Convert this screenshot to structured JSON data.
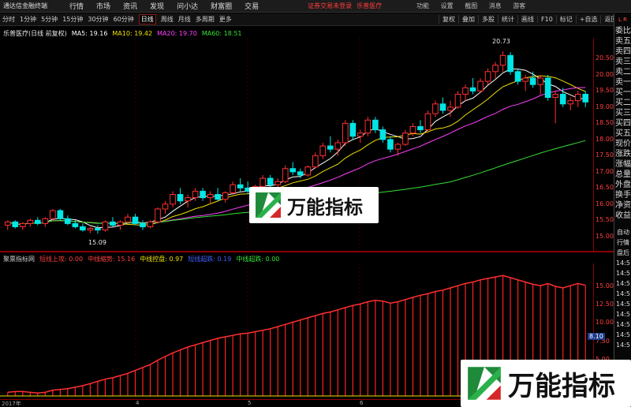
{
  "app": {
    "title": "通达信金融终端"
  },
  "menu": [
    "行情",
    "市场",
    "资讯",
    "发现",
    "问小达",
    "财富圈",
    "交易"
  ],
  "status": {
    "notice": "证券交易未登录",
    "stock": "乐普医疗"
  },
  "window_controls": [
    "功能",
    "设置",
    "截图",
    "消息"
  ],
  "guest": "游客",
  "periods": [
    "分时",
    "1分钟",
    "5分钟",
    "15分钟",
    "30分钟",
    "60分钟",
    "日线",
    "周线",
    "月线",
    "多周期",
    "更多"
  ],
  "selected_period": "日线",
  "toolbar": [
    "复权",
    "叠加",
    "多股",
    "统计",
    "画线",
    "F10",
    "标记",
    "+自选",
    "返回"
  ],
  "info": {
    "stock_label": "乐普医疗(日线 前复权)",
    "ma5": "MA5: 19.16",
    "ma10": "MA10: 19.42",
    "ma20": "MA20: 19.70",
    "ma60": "MA60: 18.51"
  },
  "annotations": {
    "high": "20.73",
    "low": "15.09"
  },
  "y_ticks": [
    "20.50",
    "20.00",
    "19.50",
    "19.00",
    "18.50",
    "18.00",
    "17.50",
    "17.00",
    "16.50",
    "16.00",
    "15.50",
    "15.00"
  ],
  "indicator": {
    "name": "聚票指标网",
    "s1": "短线上攻: 0.00",
    "s2": "中线缩势: 15.16",
    "s3": "中线控盘: 0.97",
    "s4": "短线超跌: 0.19",
    "s5": "中线超跌: 0.00"
  },
  "ind_ticks": [
    "15.00",
    "12.50",
    "10.00",
    "7.50",
    "5.00",
    "2.50"
  ],
  "ind_value_tag": "8.10",
  "x_labels": [
    "2017年",
    "4",
    "5",
    "6"
  ],
  "right_panel": {
    "top": "L R",
    "labels": [
      "委比",
      "卖五",
      "卖四",
      "卖三",
      "卖二",
      "卖一",
      "买一",
      "买二",
      "买三",
      "买四",
      "买五",
      "现价",
      "涨跌",
      "涨幅",
      "总量",
      "外盘",
      "换手",
      "净资",
      "收益"
    ],
    "labels2": [
      "自动",
      "行情",
      "盘后",
      "14:5",
      "14:5",
      "14:5",
      "14:5",
      "14:5",
      "14:5",
      "14:5",
      "14:5",
      "14:5"
    ]
  },
  "watermark": {
    "text": "万能指标"
  },
  "chart_data": {
    "type": "candlestick",
    "y_range": [
      14.8,
      20.9
    ],
    "candles": [
      [
        15.35,
        15.5,
        15.2,
        15.45
      ],
      [
        15.45,
        15.5,
        15.25,
        15.3
      ],
      [
        15.3,
        15.45,
        15.2,
        15.4
      ],
      [
        15.4,
        15.55,
        15.3,
        15.5
      ],
      [
        15.5,
        15.6,
        15.35,
        15.4
      ],
      [
        15.4,
        15.6,
        15.3,
        15.55
      ],
      [
        15.55,
        15.85,
        15.5,
        15.8
      ],
      [
        15.8,
        15.85,
        15.5,
        15.55
      ],
      [
        15.55,
        15.65,
        15.35,
        15.4
      ],
      [
        15.4,
        15.5,
        15.25,
        15.3
      ],
      [
        15.3,
        15.4,
        15.15,
        15.2
      ],
      [
        15.2,
        15.3,
        15.1,
        15.25
      ],
      [
        15.25,
        15.35,
        15.09,
        15.2
      ],
      [
        15.2,
        15.5,
        15.15,
        15.45
      ],
      [
        15.45,
        15.6,
        15.3,
        15.35
      ],
      [
        15.35,
        15.5,
        15.2,
        15.45
      ],
      [
        15.45,
        15.7,
        15.4,
        15.6
      ],
      [
        15.6,
        15.7,
        15.35,
        15.4
      ],
      [
        15.4,
        15.5,
        15.2,
        15.3
      ],
      [
        15.3,
        15.5,
        15.25,
        15.45
      ],
      [
        15.45,
        15.9,
        15.4,
        15.85
      ],
      [
        15.85,
        16.1,
        15.7,
        16.0
      ],
      [
        16.0,
        16.4,
        15.9,
        16.3
      ],
      [
        16.3,
        16.5,
        16.0,
        16.1
      ],
      [
        16.1,
        16.3,
        15.9,
        16.2
      ],
      [
        16.2,
        16.5,
        16.1,
        16.4
      ],
      [
        16.4,
        16.5,
        16.1,
        16.2
      ],
      [
        16.2,
        16.4,
        16.0,
        16.3
      ],
      [
        16.3,
        16.5,
        16.1,
        16.15
      ],
      [
        16.15,
        16.4,
        16.05,
        16.35
      ],
      [
        16.35,
        16.7,
        16.3,
        16.6
      ],
      [
        16.6,
        16.8,
        16.4,
        16.5
      ],
      [
        16.5,
        16.7,
        16.3,
        16.4
      ],
      [
        16.4,
        16.6,
        16.2,
        16.55
      ],
      [
        16.55,
        16.9,
        16.5,
        16.8
      ],
      [
        16.8,
        16.9,
        16.5,
        16.6
      ],
      [
        16.6,
        16.8,
        16.4,
        16.7
      ],
      [
        16.7,
        17.2,
        16.65,
        17.1
      ],
      [
        17.1,
        17.3,
        16.9,
        17.0
      ],
      [
        17.0,
        17.1,
        16.8,
        16.9
      ],
      [
        16.9,
        17.2,
        16.85,
        17.15
      ],
      [
        17.15,
        17.6,
        17.1,
        17.5
      ],
      [
        17.5,
        17.9,
        17.4,
        17.8
      ],
      [
        17.8,
        18.1,
        17.6,
        17.7
      ],
      [
        17.7,
        18.0,
        17.5,
        17.9
      ],
      [
        17.9,
        18.6,
        17.8,
        18.5
      ],
      [
        18.5,
        18.6,
        18.0,
        18.1
      ],
      [
        18.1,
        18.3,
        17.9,
        18.2
      ],
      [
        18.2,
        18.7,
        18.1,
        18.6
      ],
      [
        18.6,
        18.7,
        18.2,
        18.3
      ],
      [
        18.3,
        18.4,
        17.9,
        18.0
      ],
      [
        18.0,
        18.1,
        17.6,
        17.7
      ],
      [
        17.7,
        17.9,
        17.5,
        17.85
      ],
      [
        17.85,
        18.3,
        17.8,
        18.2
      ],
      [
        18.2,
        18.5,
        18.1,
        18.4
      ],
      [
        18.4,
        18.6,
        18.2,
        18.3
      ],
      [
        18.3,
        18.9,
        18.25,
        18.8
      ],
      [
        18.8,
        19.2,
        18.7,
        19.1
      ],
      [
        19.1,
        19.3,
        18.8,
        18.9
      ],
      [
        18.9,
        19.2,
        18.7,
        19.0
      ],
      [
        19.0,
        19.5,
        18.95,
        19.4
      ],
      [
        19.4,
        19.7,
        19.2,
        19.6
      ],
      [
        19.6,
        19.9,
        19.4,
        19.5
      ],
      [
        19.5,
        19.9,
        19.45,
        19.8
      ],
      [
        19.8,
        20.2,
        19.7,
        20.1
      ],
      [
        20.1,
        20.4,
        19.9,
        20.3
      ],
      [
        20.3,
        20.73,
        20.1,
        20.6
      ],
      [
        20.6,
        20.7,
        20.0,
        20.1
      ],
      [
        20.1,
        20.2,
        19.7,
        19.8
      ],
      [
        19.8,
        20.0,
        19.5,
        19.9
      ],
      [
        19.9,
        20.1,
        19.6,
        19.7
      ],
      [
        19.7,
        20.0,
        19.4,
        19.9
      ],
      [
        19.9,
        20.0,
        19.2,
        19.3
      ],
      [
        19.3,
        19.5,
        18.5,
        19.4
      ],
      [
        19.4,
        19.6,
        19.0,
        19.1
      ],
      [
        19.1,
        19.3,
        18.9,
        19.2
      ],
      [
        19.2,
        19.5,
        19.0,
        19.4
      ],
      [
        19.4,
        19.5,
        19.0,
        19.16
      ]
    ],
    "indicator_bars": [
      0.5,
      0.6,
      0.6,
      0.5,
      0.4,
      0.5,
      0.8,
      0.9,
      1.0,
      1.2,
      1.4,
      1.7,
      2.0,
      2.3,
      2.5,
      2.8,
      3.1,
      3.5,
      3.9,
      4.3,
      4.9,
      5.4,
      5.9,
      6.3,
      6.7,
      7.0,
      7.3,
      7.6,
      7.9,
      8.1,
      8.3,
      8.5,
      8.6,
      8.8,
      9.0,
      9.2,
      9.5,
      9.8,
      10.1,
      10.4,
      10.7,
      11.0,
      11.3,
      11.5,
      11.8,
      12.1,
      12.4,
      12.6,
      12.9,
      13.1,
      13.0,
      12.7,
      12.9,
      13.2,
      13.5,
      13.8,
      14.0,
      14.3,
      14.5,
      14.8,
      15.1,
      15.4,
      15.6,
      15.9,
      16.1,
      16.3,
      16.5,
      16.2,
      15.9,
      15.6,
      15.3,
      15.1,
      15.4,
      15.0,
      14.8,
      15.1,
      15.4,
      15.16
    ]
  }
}
